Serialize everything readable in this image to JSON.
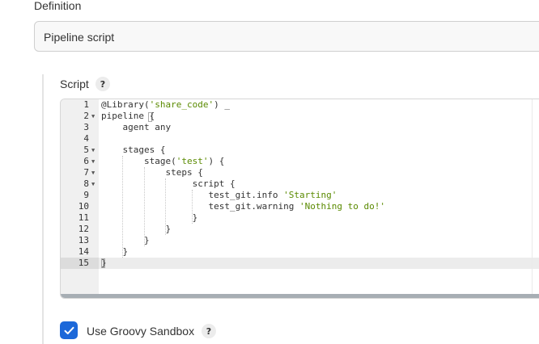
{
  "definition": {
    "label": "Definition",
    "selected": "Pipeline script"
  },
  "script": {
    "label": "Script",
    "help": "?",
    "lines": [
      {
        "num": "1",
        "fold": "",
        "segments": [
          {
            "t": "@Library(",
            "c": ""
          },
          {
            "t": "'share_code'",
            "c": "str"
          },
          {
            "t": ") _",
            "c": ""
          }
        ]
      },
      {
        "num": "2",
        "fold": "▼",
        "segments": [
          {
            "t": "pipeline {",
            "c": ""
          }
        ]
      },
      {
        "num": "3",
        "fold": "",
        "segments": [
          {
            "t": "    agent any",
            "c": ""
          }
        ]
      },
      {
        "num": "4",
        "fold": "",
        "segments": [
          {
            "t": "",
            "c": ""
          }
        ]
      },
      {
        "num": "5",
        "fold": "▼",
        "segments": [
          {
            "t": "    stages {",
            "c": ""
          }
        ]
      },
      {
        "num": "6",
        "fold": "▼",
        "segments": [
          {
            "t": "        stage(",
            "c": ""
          },
          {
            "t": "'test'",
            "c": "str"
          },
          {
            "t": ") {",
            "c": ""
          }
        ]
      },
      {
        "num": "7",
        "fold": "▼",
        "segments": [
          {
            "t": "            steps {",
            "c": ""
          }
        ]
      },
      {
        "num": "8",
        "fold": "▼",
        "segments": [
          {
            "t": "                 script {",
            "c": ""
          }
        ]
      },
      {
        "num": "9",
        "fold": "",
        "segments": [
          {
            "t": "                    test_git.info ",
            "c": ""
          },
          {
            "t": "'Starting'",
            "c": "str"
          }
        ]
      },
      {
        "num": "10",
        "fold": "",
        "segments": [
          {
            "t": "                    test_git.warning ",
            "c": ""
          },
          {
            "t": "'Nothing to do!'",
            "c": "str"
          }
        ]
      },
      {
        "num": "11",
        "fold": "",
        "segments": [
          {
            "t": "                 }",
            "c": ""
          }
        ]
      },
      {
        "num": "12",
        "fold": "",
        "segments": [
          {
            "t": "            }",
            "c": ""
          }
        ]
      },
      {
        "num": "13",
        "fold": "",
        "segments": [
          {
            "t": "        }",
            "c": ""
          }
        ]
      },
      {
        "num": "14",
        "fold": "",
        "segments": [
          {
            "t": "    }",
            "c": ""
          }
        ]
      },
      {
        "num": "15",
        "fold": "",
        "segments": [
          {
            "t": "}",
            "c": ""
          }
        ]
      }
    ],
    "active_line": 15
  },
  "sandbox": {
    "checked": true,
    "label": "Use Groovy Sandbox",
    "help": "?"
  },
  "colors": {
    "accent": "#1c68d9",
    "string": "#5a8a00"
  },
  "icons": {
    "fold_marker": "caret-down-icon",
    "checkbox": "checkmark-icon",
    "help": "question-mark-icon"
  }
}
